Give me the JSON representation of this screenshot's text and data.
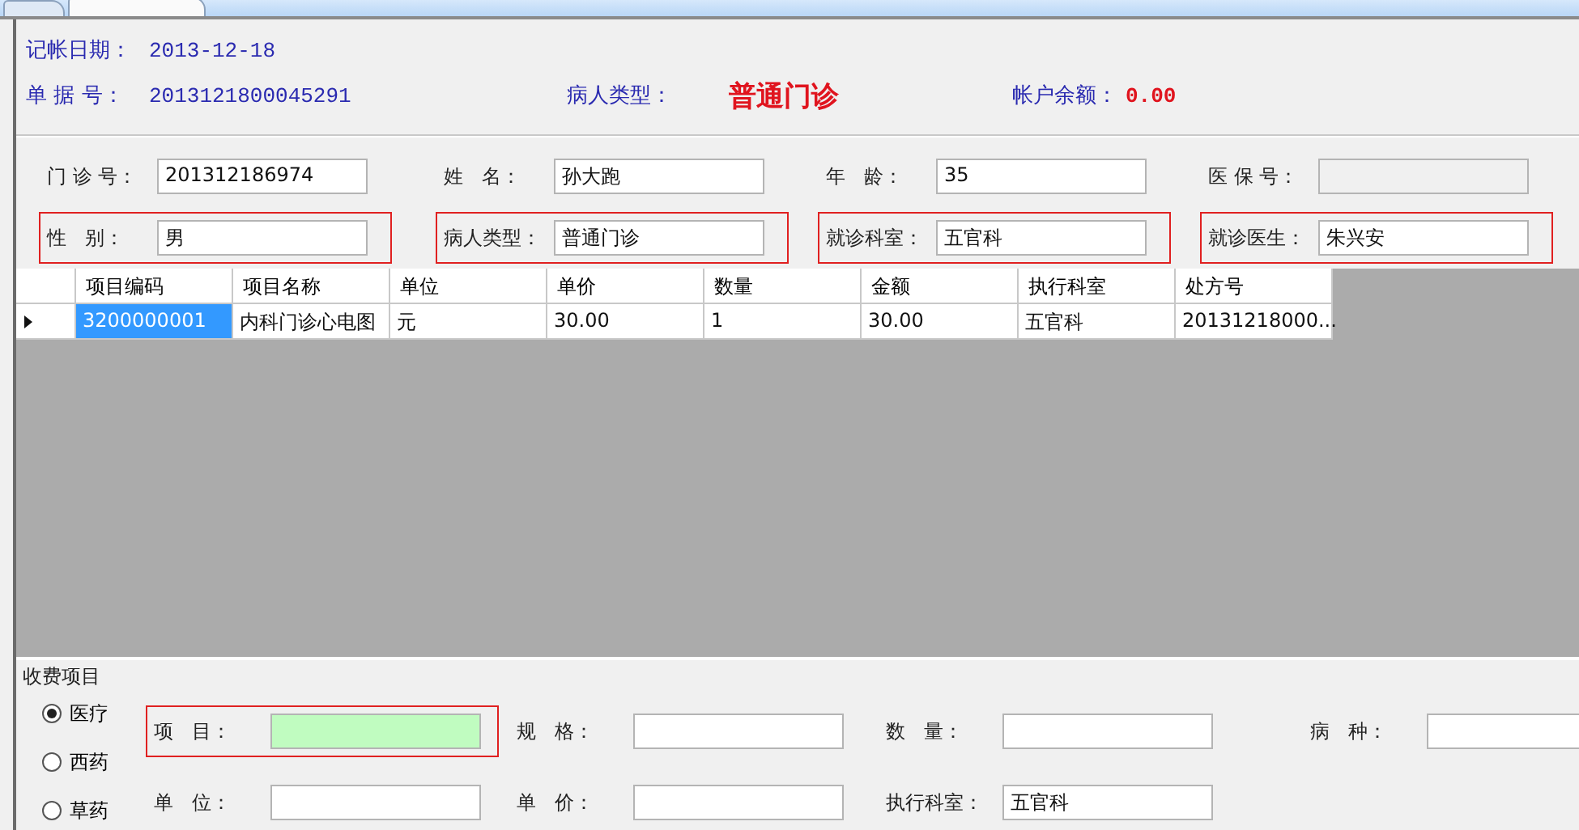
{
  "tabs": [
    {
      "selected": false
    },
    {
      "selected": true
    }
  ],
  "header": {
    "date": {
      "label": "记帐日期：",
      "value": "2013-12-18"
    },
    "bill_no": {
      "label": "单 据 号：",
      "value": "2013121800045291"
    },
    "patient_type": {
      "label": "病人类型：",
      "value": "普通门诊"
    },
    "balance": {
      "label": "帐户余额：",
      "value": "0.00"
    }
  },
  "patient": {
    "fields": [
      {
        "label": "门 诊 号：",
        "value": "201312186974",
        "highlighted": false,
        "disabled": false
      },
      {
        "label": "姓   名：",
        "value": "孙大跑",
        "highlighted": false,
        "disabled": false
      },
      {
        "label": "年   龄：",
        "value": "35",
        "highlighted": false,
        "disabled": false
      },
      {
        "label": "医 保 号：",
        "highlighted": false,
        "disabled": true
      },
      {
        "label": "性   别：",
        "value": "男",
        "highlighted": true,
        "disabled": false
      },
      {
        "label": "病人类型：",
        "value": "普通门诊",
        "highlighted": true,
        "disabled": false
      },
      {
        "label": "就诊科室：",
        "value": "五官科",
        "highlighted": true,
        "disabled": false
      },
      {
        "label": "就诊医生：",
        "value": "朱兴安",
        "highlighted": true,
        "disabled": false
      }
    ]
  },
  "table": {
    "columns": [
      "项目编码",
      "项目名称",
      "单位",
      "单价",
      "数量",
      "金额",
      "执行科室",
      "处方号"
    ],
    "rows": [
      {
        "selected": true,
        "cells": [
          {
            "text": "3200000001",
            "selected": true
          },
          {
            "text": "内科门诊心电图",
            "selected": false
          },
          {
            "text": "元",
            "selected": false
          },
          {
            "text": "30.00",
            "selected": false
          },
          {
            "text": "1",
            "selected": false
          },
          {
            "text": "30.00",
            "selected": false
          },
          {
            "text": "五官科",
            "selected": false
          },
          {
            "text": "20131218000...",
            "selected": false
          }
        ]
      }
    ]
  },
  "charges": {
    "legend": "收费项目",
    "types": [
      {
        "label": "医疗",
        "selected": true
      },
      {
        "label": "西药",
        "selected": false
      },
      {
        "label": "草药",
        "selected": false
      }
    ],
    "fields": [
      {
        "label": "项   目：",
        "highlighted": true,
        "focused": true
      },
      {
        "label": "规   格：",
        "highlighted": false,
        "focused": false
      },
      {
        "label": "数   量：",
        "highlighted": false,
        "focused": false
      },
      {
        "label": "病   种：",
        "highlighted": false,
        "focused": false
      },
      {
        "label": "单   位：",
        "highlighted": false,
        "focused": false
      },
      {
        "label": "单   价：",
        "highlighted": false,
        "focused": false
      },
      {
        "label": "执行科室：",
        "value": "五官科",
        "highlighted": false,
        "focused": false
      }
    ]
  }
}
